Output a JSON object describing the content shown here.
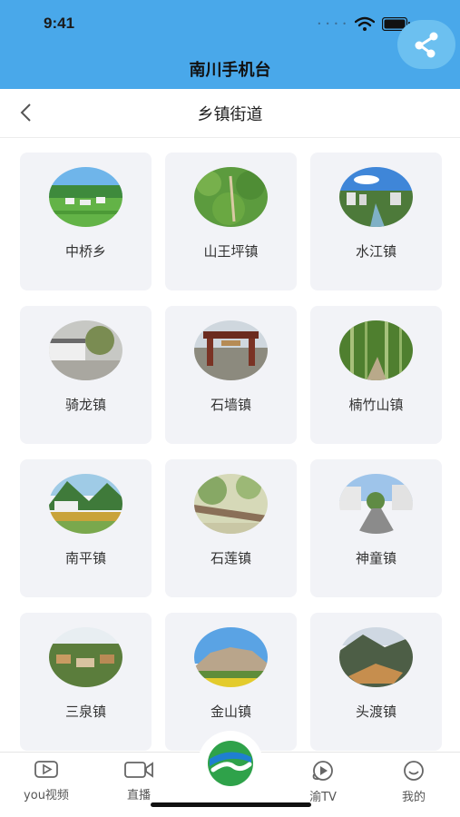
{
  "status_bar": {
    "time": "9:41",
    "carrier_dots": "• • • •"
  },
  "header": {
    "app_title": "南川手机台"
  },
  "nav": {
    "page_title": "乡镇街道"
  },
  "towns": [
    {
      "name": "中桥乡"
    },
    {
      "name": "山王坪镇"
    },
    {
      "name": "水江镇"
    },
    {
      "name": "骑龙镇"
    },
    {
      "name": "石墙镇"
    },
    {
      "name": "楠竹山镇"
    },
    {
      "name": "南平镇"
    },
    {
      "name": "石莲镇"
    },
    {
      "name": "神童镇"
    },
    {
      "name": "三泉镇"
    },
    {
      "name": "金山镇"
    },
    {
      "name": "头渡镇"
    }
  ],
  "tab_bar": {
    "items": [
      {
        "label": "you视频",
        "icon": "video-play-icon"
      },
      {
        "label": "直播",
        "icon": "camera-icon"
      },
      {
        "label": "",
        "icon": "center-logo-icon"
      },
      {
        "label": "渝TV",
        "icon": "tv-icon"
      },
      {
        "label": "我的",
        "icon": "smiley-icon"
      }
    ]
  },
  "colors": {
    "header_bg": "#49a8ea",
    "card_bg": "#f2f3f7",
    "logo_green": "#2fa24a",
    "logo_blue": "#1f7fd0"
  }
}
